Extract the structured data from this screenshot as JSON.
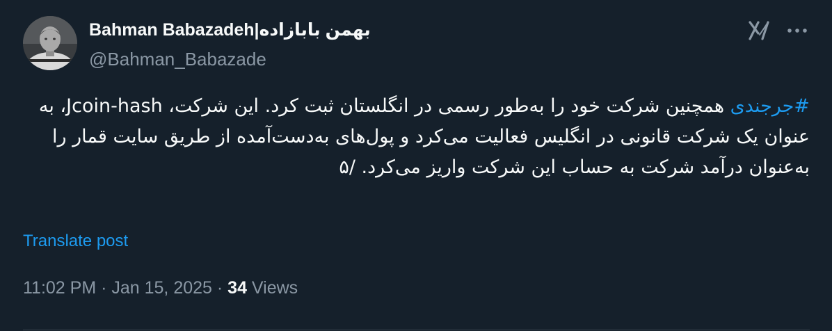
{
  "author": {
    "display_name": "Bahman Babazadeh|بهمن بابازاده",
    "handle": "@Bahman_Babazade"
  },
  "icons": {
    "grok": "grok-icon",
    "more": "more-icon"
  },
  "post": {
    "hashtag": "#جرجندی",
    "text": " همچنین شرکت خود را به‌طور رسمی در انگلستان ثبت کرد. این شرکت، Jcoin-hash، به عنوان یک شرکت قانونی در انگلیس فعالیت می‌کرد و پول‌های به‌دست‌آمده از طریق سایت قمار را به‌عنوان درآمد شرکت به حساب این شرکت واریز می‌کرد. /۵"
  },
  "translate_label": "Translate post",
  "meta": {
    "time": "11:02 PM",
    "separator": " · ",
    "date": "Jan 15, 2025",
    "views_count": "34",
    "views_label": " Views"
  },
  "colors": {
    "background": "#15202b",
    "text": "#f7f9f9",
    "secondary": "#8b98a5",
    "accent": "#1d9bf0"
  }
}
